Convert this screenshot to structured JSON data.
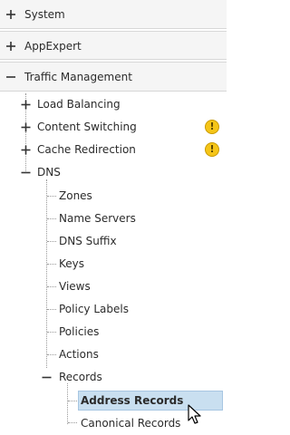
{
  "tree": {
    "root_items": [
      {
        "label": "System",
        "state": "collapsed"
      },
      {
        "label": "AppExpert",
        "state": "collapsed"
      },
      {
        "label": "Traffic Management",
        "state": "expanded"
      }
    ],
    "traffic_management_children": [
      {
        "label": "Load Balancing",
        "state": "collapsed",
        "warning": false
      },
      {
        "label": "Content Switching",
        "state": "collapsed",
        "warning": true
      },
      {
        "label": "Cache Redirection",
        "state": "collapsed",
        "warning": true
      },
      {
        "label": "DNS",
        "state": "expanded",
        "warning": false
      }
    ],
    "dns_children": [
      "Zones",
      "Name Servers",
      "DNS Suffix",
      "Keys",
      "Views",
      "Policy Labels",
      "Policies",
      "Actions"
    ],
    "records": {
      "label": "Records",
      "state": "expanded",
      "children": [
        {
          "label": "Address Records",
          "selected": true
        },
        {
          "label": "Canonical Records",
          "selected": false
        }
      ]
    },
    "warning_glyph": "!",
    "warning_icon": "warning-icon"
  },
  "colors": {
    "root_row_bg": "#f5f5f5",
    "selection_bg": "#c9dff0",
    "warning": "#f5c518"
  }
}
